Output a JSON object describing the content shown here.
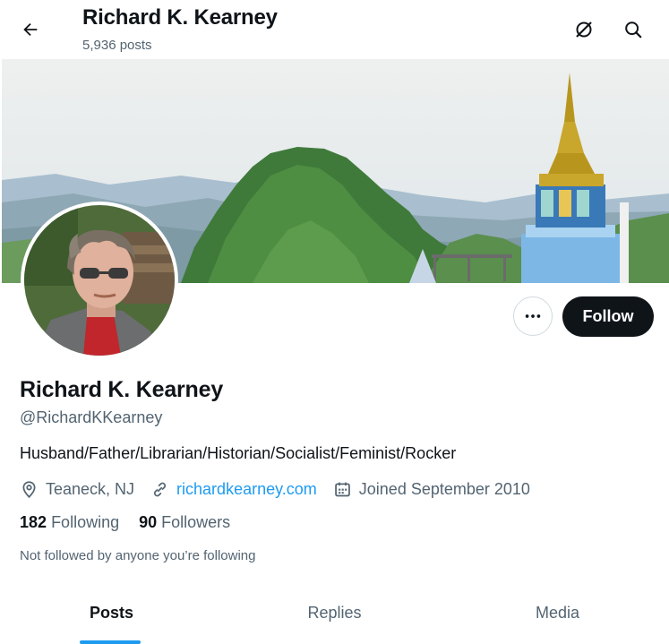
{
  "header": {
    "title": "Richard K. Kearney",
    "posts_count": "5,936 posts"
  },
  "icons": {
    "back": "arrow-left-icon",
    "grok": "grok-icon",
    "search": "search-icon",
    "more": "more-horizontal-icon",
    "location": "location-pin-icon",
    "link": "link-icon",
    "calendar": "calendar-icon"
  },
  "profile": {
    "display_name": "Richard K. Kearney",
    "handle": "@RichardKKearney",
    "bio": "Husband/Father/Librarian/Historian/Socialist/Feminist/Rocker",
    "location": "Teaneck, NJ",
    "website": "richardkearney.com",
    "joined": "Joined September 2010",
    "following_count": "182",
    "following_label": "Following",
    "followers_count": "90",
    "followers_label": "Followers",
    "followed_by_note": "Not followed by anyone you’re following"
  },
  "actions": {
    "follow_label": "Follow"
  },
  "tabs": [
    {
      "label": "Posts",
      "active": true
    },
    {
      "label": "Replies",
      "active": false
    },
    {
      "label": "Media",
      "active": false
    }
  ],
  "colors": {
    "accent": "#1d9bf0",
    "text_primary": "#0f1419",
    "text_secondary": "#536471",
    "button_dark": "#0f1419"
  }
}
